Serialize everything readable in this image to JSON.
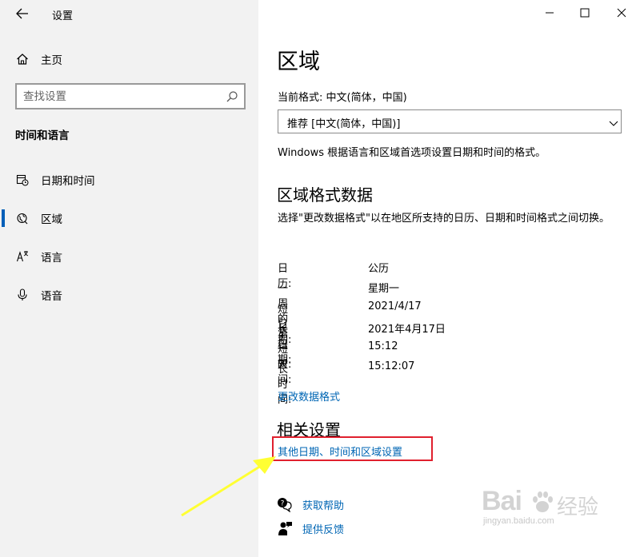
{
  "window": {
    "title": "设置",
    "controls": [
      "minimize-icon",
      "maximize-icon",
      "close-icon"
    ]
  },
  "sidebar": {
    "home_label": "主页",
    "search_placeholder": "查找设置",
    "category": "时间和语言",
    "items": [
      {
        "label": "日期和时间",
        "icon": "calendar-clock-icon",
        "selected": false
      },
      {
        "label": "区域",
        "icon": "globe-region-icon",
        "selected": true
      },
      {
        "label": "语言",
        "icon": "language-icon",
        "selected": false
      },
      {
        "label": "语音",
        "icon": "microphone-icon",
        "selected": false
      }
    ]
  },
  "main": {
    "title": "区域",
    "current_format_label": "当前格式: 中文(简体，中国)",
    "format_dropdown_value": "推荐 [中文(简体，中国)]",
    "format_description": "Windows 根据语言和区域首选项设置日期和时间的格式。",
    "regional_data_title": "区域格式数据",
    "regional_data_description": "选择\"更改数据格式\"以在地区所支持的日历、日期和时间格式之间切换。",
    "format_rows": [
      {
        "key": "日历:",
        "value": "公历"
      },
      {
        "key": "一周的第一天:",
        "value": "星期一"
      },
      {
        "key": "短日期:",
        "value": "2021/4/17"
      },
      {
        "key": "长日期:",
        "value": "2021年4月17日"
      },
      {
        "key": "短时间:",
        "value": "15:12"
      },
      {
        "key": "长时间:",
        "value": "15:12:07"
      }
    ],
    "change_format_link": "更改数据格式",
    "related_settings_title": "相关设置",
    "related_link": "其他日期、时间和区域设置",
    "help_link": "获取帮助",
    "feedback_link": "提供反馈"
  },
  "annotation": {
    "highlight_color": "#e0202e",
    "arrow_color": "#ffff33"
  },
  "watermark": {
    "brand": "Bai",
    "brand_cn": "经验",
    "url": "jingyan.baidu.com"
  },
  "colors": {
    "accent": "#005fb8",
    "link": "#0066b4",
    "sidebar_bg": "#f2f2f2"
  }
}
